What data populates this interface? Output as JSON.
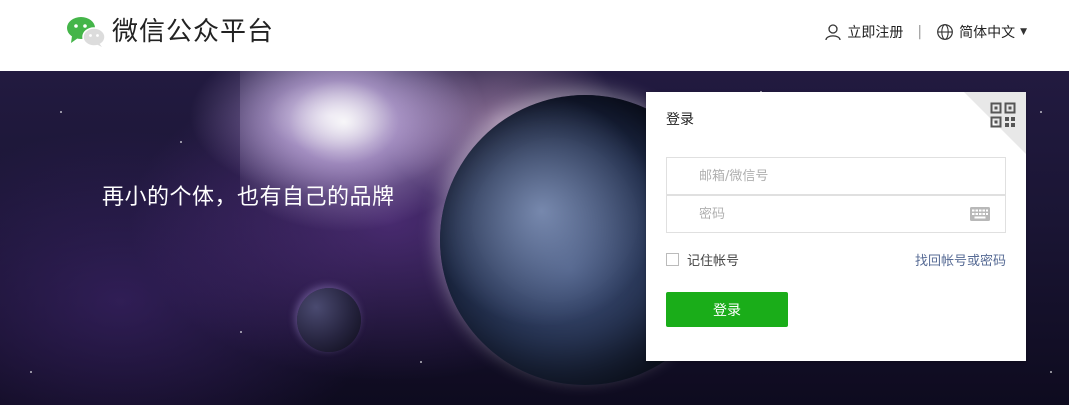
{
  "header": {
    "brand": "微信公众平台",
    "register_label": "立即注册",
    "separator": "|",
    "language_label": "简体中文",
    "caret": "▼"
  },
  "banner": {
    "slogan": "再小的个体，也有自己的品牌"
  },
  "login": {
    "title": "登录",
    "account_placeholder": "邮箱/微信号",
    "account_value": "",
    "password_placeholder": "密码",
    "password_value": "",
    "remember_label": "记住帐号",
    "remember_checked": false,
    "forgot_label": "找回帐号或密码",
    "submit_label": "登录"
  },
  "colors": {
    "brand_green": "#1aad19",
    "link_blue": "#576b95",
    "logo_green": "#44b549"
  },
  "icons": [
    "wechat-logo-icon",
    "user-icon",
    "globe-icon",
    "chevron-down-icon",
    "qr-code-icon",
    "keyboard-icon"
  ]
}
